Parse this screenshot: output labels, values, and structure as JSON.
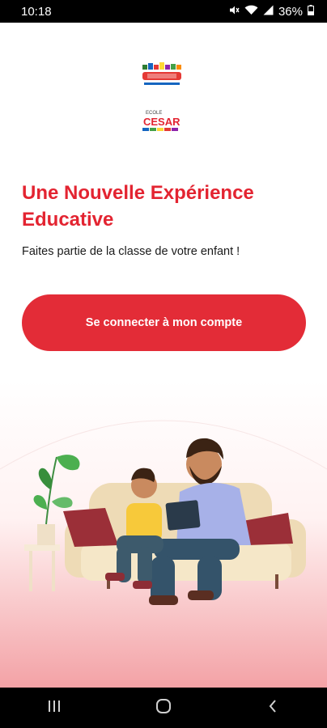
{
  "status_bar": {
    "time": "10:18",
    "battery": "36%"
  },
  "logos": {
    "arabic_brand": "مدرسة سيزار",
    "latin_brand_top": "ECOLE",
    "latin_brand": "CESAR"
  },
  "headline": "Une Nouvelle Expérience Educative",
  "subline": "Faites partie de la classe de votre enfant !",
  "login_button": "Se connecter à mon compte",
  "colors": {
    "accent": "#e32431",
    "button": "#e32c37",
    "status_bar": "#000000"
  },
  "icons": [
    "mute-icon",
    "wifi-icon",
    "signal-icon",
    "battery-icon",
    "recents-icon",
    "home-icon",
    "back-icon"
  ]
}
